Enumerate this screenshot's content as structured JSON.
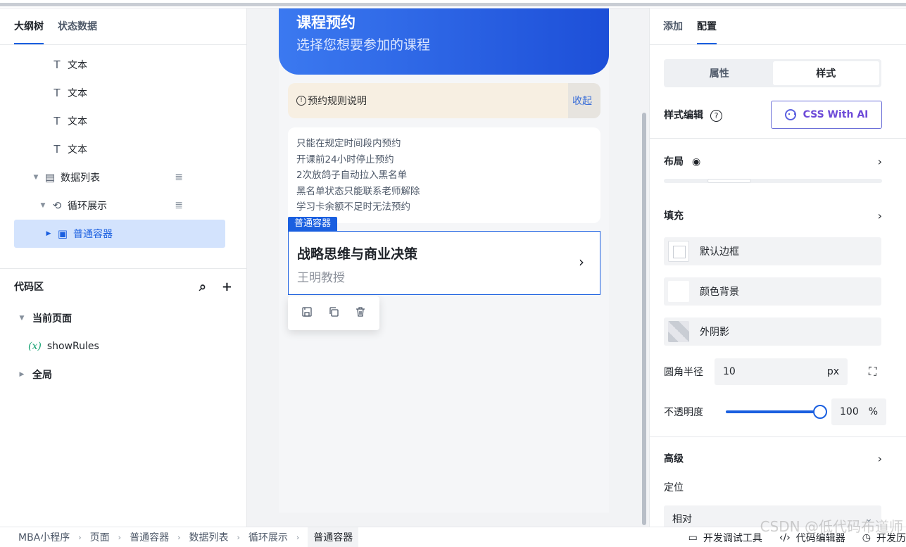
{
  "left_panel": {
    "tabs": [
      "大纲树",
      "状态数据"
    ],
    "tree": [
      {
        "label": "文本",
        "icon": "text-icon"
      },
      {
        "label": "文本",
        "icon": "text-icon"
      },
      {
        "label": "文本",
        "icon": "text-icon"
      },
      {
        "label": "文本",
        "icon": "text-icon"
      },
      {
        "label": "数据列表",
        "icon": "list-icon"
      },
      {
        "label": "循环展示",
        "icon": "loop-icon"
      },
      {
        "label": "普通容器",
        "icon": "container-icon"
      }
    ],
    "code": {
      "title": "代码区",
      "current_page": "当前页面",
      "variable_prefix": "(x)",
      "variable": "showRules",
      "global": "全局"
    }
  },
  "canvas": {
    "hero_title": "课程预约",
    "hero_subtitle": "选择您想要参加的课程",
    "notice_text": "预约规则说明",
    "notice_action": "收起",
    "rules": [
      "只能在规定时间段内预约",
      "开课前24小时停止预约",
      "2次放鸽子自动拉入黑名单",
      "黑名单状态只能联系老师解除",
      "学习卡余额不足时无法预约"
    ],
    "selected_tag": "普通容器",
    "card_title": "战略思维与商业决策",
    "card_subtitle": "王明教授"
  },
  "right_panel": {
    "tabs": [
      "添加",
      "配置"
    ],
    "segments": [
      "属性",
      "样式"
    ],
    "style_edit_label": "样式编辑",
    "ai_button": "CSS With AI",
    "layout_label": "布局",
    "fill_label": "填充",
    "fill_items": [
      "默认边框",
      "颜色背景",
      "外阴影"
    ],
    "radius_label": "圆角半径",
    "radius_value": "10",
    "radius_unit": "px",
    "opacity_label": "不透明度",
    "opacity_value": "100",
    "opacity_unit": "%",
    "opacity_level": 1.0,
    "advanced_label": "高级",
    "position_label": "定位",
    "position_value": "相对"
  },
  "bottom_bar": {
    "breadcrumbs": [
      "MBA小程序",
      "页面",
      "普通容器",
      "数据列表",
      "循环展示",
      "普通容器"
    ],
    "tools": [
      "开发调试工具",
      "代码编辑器",
      "开发历"
    ],
    "watermark": "CSDN @低代码布道师"
  },
  "colors": {
    "accent": "#1a5fe0",
    "hero_start": "#3b79f0",
    "hero_end": "#1d4fd8",
    "notice_bg": "#f7efe2",
    "ai_text": "#6d4ad8"
  }
}
